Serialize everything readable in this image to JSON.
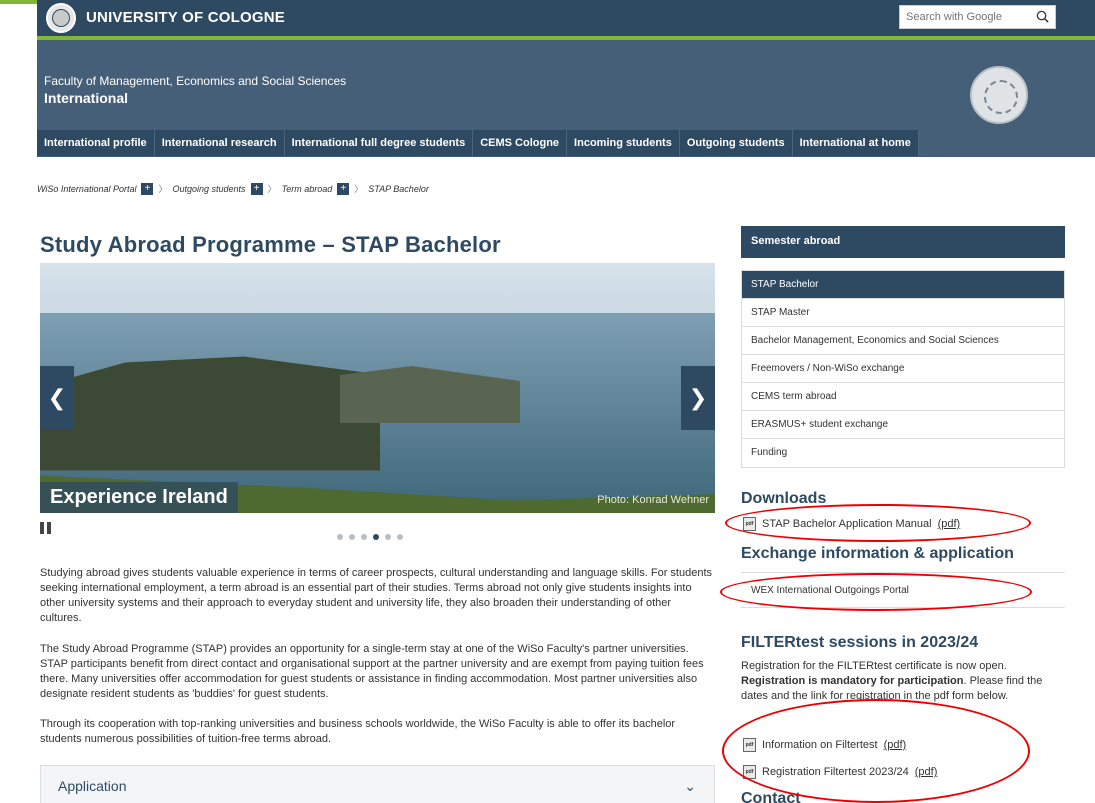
{
  "top": {
    "university": "UNIVERSITY OF COLOGNE",
    "search_placeholder": "Search with Google"
  },
  "header": {
    "faculty": "Faculty of Management, Economics and Social Sciences",
    "section": "International"
  },
  "nav": {
    "items": [
      "International profile",
      "International research",
      "International full degree students",
      "CEMS Cologne",
      "Incoming students",
      "Outgoing students",
      "International at home"
    ]
  },
  "breadcrumb": {
    "items": [
      "WiSo International Portal",
      "Outgoing students",
      "Term abroad",
      "STAP Bachelor"
    ]
  },
  "main": {
    "title": "Study Abroad Programme – STAP Bachelor",
    "slider": {
      "caption": "Experience Ireland",
      "credit": "Photo: Konrad Wehner",
      "prev": "❮",
      "next": "❯",
      "slide_count": 6,
      "active_slide": 4
    },
    "paragraphs": [
      "Studying abroad gives students valuable experience in terms of career prospects, cultural understanding and language skills. For students seeking international employment, a term abroad is an essential part of their studies. Terms abroad not only give students insights into other university systems and their approach to everyday student and university life, they also broaden their understanding of other cultures.",
      "The Study Abroad Programme (STAP) provides an opportunity for a single-term stay at one of the WiSo Faculty's partner universities. STAP participants benefit from direct contact and organisational support at the partner university and are exempt from paying tuition fees there. Many universities offer accommodation for guest students or assistance in finding accommodation. Most partner universities also designate resident students as 'buddies' for guest students.",
      "Through its cooperation with top-ranking universities and business schools worldwide, the WiSo Faculty is able to offer its bachelor students numerous possibilities of tuition-free terms abroad."
    ],
    "accordion": {
      "label": "Application",
      "chevron": "⌄"
    }
  },
  "sidebar": {
    "heading": "Semester abroad",
    "items": [
      "STAP Bachelor",
      "STAP Master",
      "Bachelor Management, Economics and Social Sciences",
      "Freemovers / Non-WiSo exchange",
      "CEMS term abroad",
      "ERASMUS+ student exchange",
      "Funding"
    ],
    "downloads_heading": "Downloads",
    "downloads": [
      {
        "label": "STAP Bachelor Application Manual",
        "ext": "(pdf)"
      }
    ],
    "exchange_heading": "Exchange information & application",
    "exchange_link": "WEX International Outgoings Portal",
    "filter_heading": "FILTERtest sessions in 2023/24",
    "filter_text_1": "Registration for the FILTERtest certificate is now open.",
    "filter_text_bold": "Registration is mandatory for participation",
    "filter_text_2": ". Please find the dates and the link for registration in the pdf form below.",
    "filter_links": [
      {
        "label": "Information on Filtertest",
        "ext": "(pdf)"
      },
      {
        "label": "Registration Filtertest 2023/24",
        "ext": "(pdf)"
      }
    ],
    "contact_heading": "Contact"
  },
  "colors": {
    "brand_navy": "#2e4a62",
    "brand_green": "#82b735",
    "annotation_red": "#e00000"
  }
}
